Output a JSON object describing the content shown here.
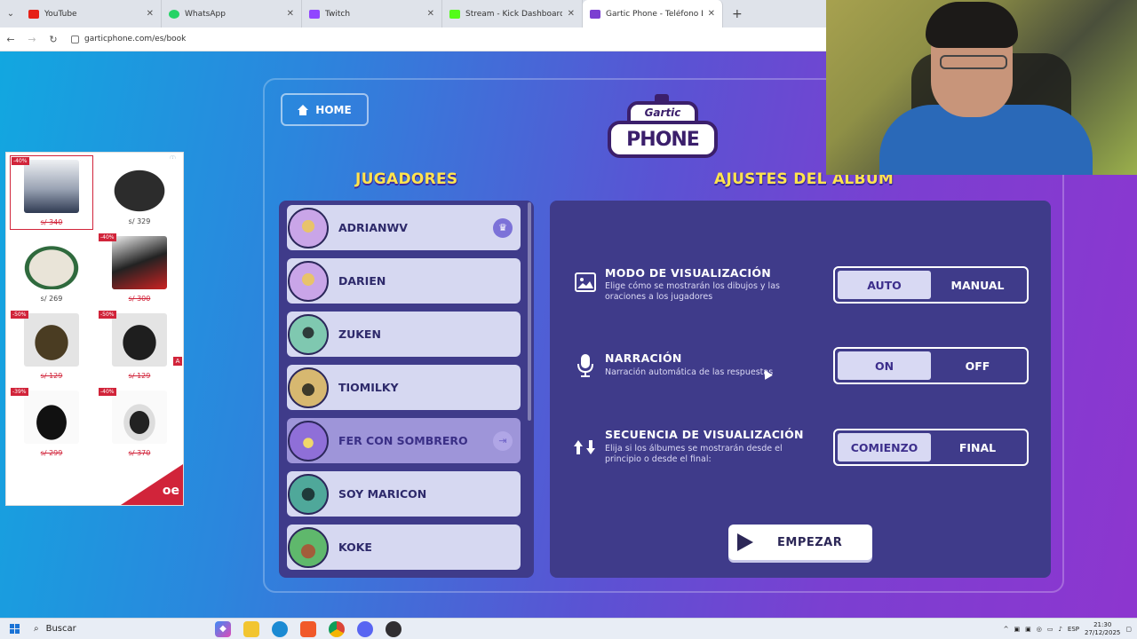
{
  "browser": {
    "tabs": [
      {
        "label": "YouTube",
        "color": "#e62117"
      },
      {
        "label": "WhatsApp",
        "color": "#25d366"
      },
      {
        "label": "Twitch",
        "color": "#9146ff"
      },
      {
        "label": "Stream - Kick Dashboard",
        "color": "#53fc18"
      },
      {
        "label": "Gartic Phone - Teléfono Descon",
        "color": "#7b3fd1"
      }
    ],
    "url": "garticphone.com/es/book"
  },
  "game": {
    "home_label": "HOME",
    "logo_top": "Gartic",
    "logo_main": "PHONE",
    "players_title": "JUGADORES",
    "settings_title": "AJUSTES DEL ALBUM",
    "players": [
      {
        "name": "ADRIANWV",
        "badge": "♛",
        "avatar_color": "#c9a5e8"
      },
      {
        "name": "DARIEN",
        "badge": "",
        "avatar_color": "#c9a5e8"
      },
      {
        "name": "ZUKEN",
        "badge": "",
        "avatar_color": "#7fc8b0"
      },
      {
        "name": "TIOMILKY",
        "badge": "",
        "avatar_color": "#d7b870"
      },
      {
        "name": "FER CON SOMBRERO",
        "badge": "⇥",
        "avatar_color": "#8f6fd8"
      },
      {
        "name": "SOY MARICON",
        "badge": "",
        "avatar_color": "#4fa89a"
      },
      {
        "name": "KOKE",
        "badge": "",
        "avatar_color": "#5fb86c"
      }
    ],
    "settings": [
      {
        "title": "MODO DE VISUALIZACIÓN",
        "desc": "Elige cómo se mostrarán los dibujos y las oraciones a los jugadores",
        "icon": "image-icon",
        "options": [
          "AUTO",
          "MANUAL"
        ],
        "selected": "AUTO"
      },
      {
        "title": "NARRACIÓN",
        "desc": "Narración automática de las respuestas",
        "icon": "microphone-icon",
        "options": [
          "ON",
          "OFF"
        ],
        "selected": "ON"
      },
      {
        "title": "SECUENCIA DE VISUALIZACIÓN",
        "desc": "Elija si los álbumes se mostrarán desde el principio o desde el final:",
        "icon": "sort-arrows-icon",
        "options": [
          "COMIENZO",
          "FINAL"
        ],
        "selected": "COMIENZO"
      }
    ],
    "start_label": "EMPEZAR"
  },
  "ad": {
    "items": [
      {
        "price": "s/ 340",
        "disc": "-40%",
        "strike": true
      },
      {
        "price": "s/ 329",
        "disc": "",
        "strike": false
      },
      {
        "price": "s/ 269",
        "disc": "",
        "strike": false
      },
      {
        "price": "s/ 300",
        "disc": "-40%",
        "strike": true
      },
      {
        "price": "s/ 129",
        "disc": "-50%",
        "strike": true
      },
      {
        "price": "s/ 129",
        "disc": "-50%",
        "strike": true
      },
      {
        "price": "s/ 299",
        "disc": "-39%",
        "strike": true
      },
      {
        "price": "s/ 370",
        "disc": "-40%",
        "strike": true
      }
    ],
    "brand": "oe"
  },
  "taskbar": {
    "search_label": "Buscar",
    "lang": "ESP",
    "time": "21:30",
    "date": "27/12/2025"
  }
}
